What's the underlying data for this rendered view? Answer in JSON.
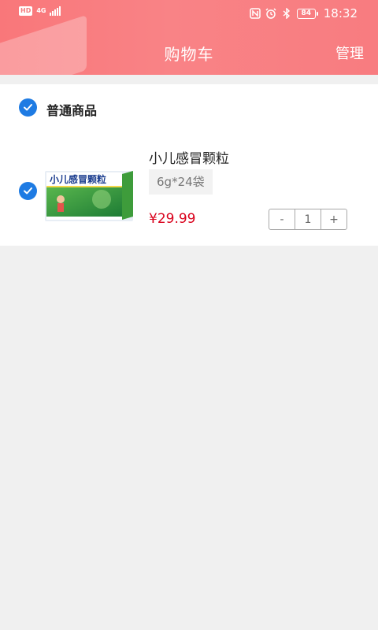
{
  "status_bar": {
    "hd": "HD",
    "network": "4G",
    "battery": "84",
    "time": "18:32"
  },
  "header": {
    "title": "购物车",
    "manage_label": "管理",
    "color": "#f98386"
  },
  "cart": {
    "group_title": "普通商品",
    "items": [
      {
        "name": "小儿感冒颗粒",
        "spec": "6g*24袋",
        "price": "¥29.99",
        "quantity": "1",
        "selected": true,
        "image_text": "小儿感冒颗粒"
      }
    ],
    "decrement_label": "-",
    "increment_label": "+"
  },
  "colors": {
    "accent": "#1e7be3",
    "price": "#d9001b",
    "background": "#f0f0f0"
  }
}
